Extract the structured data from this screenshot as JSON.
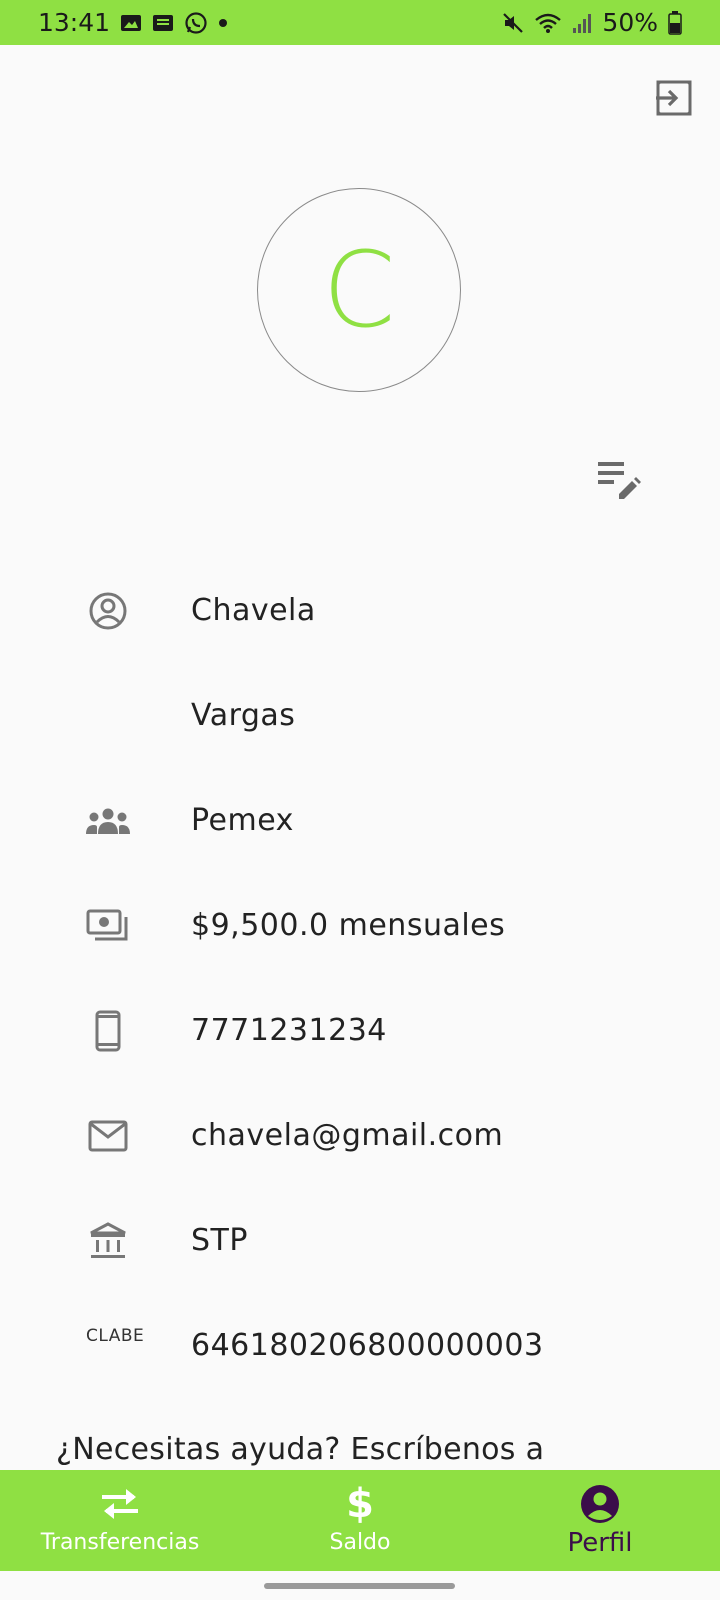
{
  "status_bar": {
    "time": "13:41",
    "battery": "50%"
  },
  "profile": {
    "avatar_initial": "C",
    "first_name": "Chavela",
    "last_name": "Vargas",
    "company": "Pemex",
    "salary": "$9,500.0 mensuales",
    "phone": "7771231234",
    "email": "chavela@gmail.com",
    "bank": "STP",
    "clabe_label": "CLABE",
    "clabe": "646180206800000003"
  },
  "help": {
    "text": "¿Necesitas ayuda? Escríbenos a"
  },
  "bottom_nav": {
    "items": [
      {
        "label": "Transferencias",
        "icon": "swap-arrows-icon"
      },
      {
        "label": "Saldo",
        "icon": "dollar-icon"
      },
      {
        "label": "Perfil",
        "icon": "account-circle-icon",
        "active": true
      }
    ]
  },
  "colors": {
    "accent": "#8fe043",
    "active_nav": "#3b0d4a",
    "icon_gray": "#777777"
  }
}
